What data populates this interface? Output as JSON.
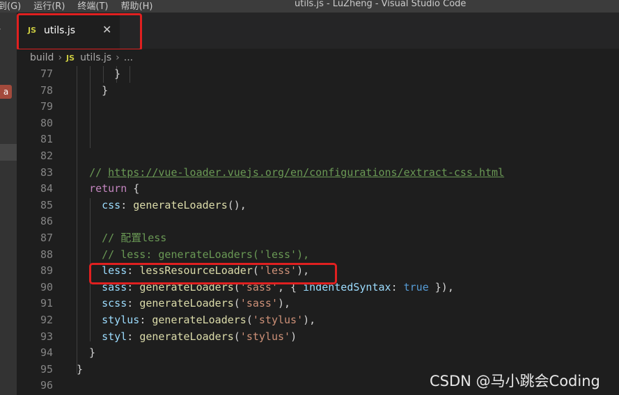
{
  "titlebar": {
    "menus": [
      "到(G)",
      "运行(R)",
      "终端(T)",
      "帮助(H)"
    ],
    "title": "utils.js - LuZheng - Visual Studio Code"
  },
  "activity": {
    "badge": "a"
  },
  "tab": {
    "js_label": "JS",
    "label": "utils.js",
    "close": "✕"
  },
  "breadcrumb": {
    "folder": "build",
    "js_label": "JS",
    "file": "utils.js",
    "more": "..."
  },
  "editor": {
    "line_numbers": [
      "77",
      "78",
      "79",
      "80",
      "81",
      "82",
      "83",
      "84",
      "85",
      "86",
      "87",
      "88",
      "89",
      "90",
      "91",
      "92",
      "93",
      "94",
      "95",
      "96"
    ],
    "comment_prefix": "// ",
    "url": "https://vue-loader.vuejs.org/en/configurations/extract-css.html",
    "return_kw": "return",
    "line_84_rest": " {",
    "css_key": "css",
    "gen_fn": "generateLoaders",
    "line_85_rest": "(),",
    "comment_87": "// 配置less",
    "comment_88": "// less: generateLoaders('less'),",
    "less_key": "less",
    "less_fn": "lessResourceLoader",
    "less_str": "'less'",
    "sass_key": "sass",
    "sass_str": "'sass'",
    "indented_key": "indentedSyntax",
    "bool_true": "true",
    "scss_key": "scss",
    "stylus_key": "stylus",
    "stylus_str": "'stylus'",
    "styl_key": "styl"
  },
  "watermark": "CSDN @马小跳会Coding"
}
